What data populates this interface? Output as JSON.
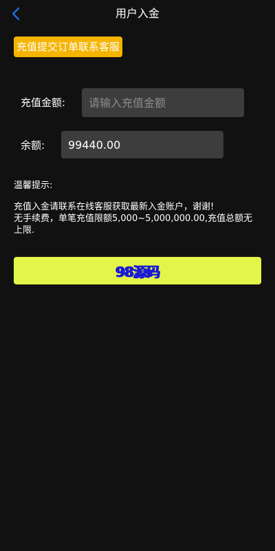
{
  "header": {
    "title": "用户入金",
    "back_icon": "chevron-left-icon",
    "back_icon_color": "#1e6fd9"
  },
  "contact_tag": {
    "label": "充值提交订单联系客服",
    "color": "#f5b400"
  },
  "form": {
    "amount_label": "充值金额:",
    "amount_placeholder": "请输入充值金额",
    "amount_value": "",
    "balance_label": "余额:",
    "balance_value": "99440.00"
  },
  "tips": {
    "title": "温馨提示:",
    "line1": "充值入金请联系在线客服获取最新入金账户，谢谢!",
    "line2": "无手续费，单笔充值限额5,000~5,000,000.00,充值总额无上限."
  },
  "submit": {
    "label": "98源码",
    "bg_color": "#e4f54a",
    "text_color": "#1a1ad6"
  }
}
